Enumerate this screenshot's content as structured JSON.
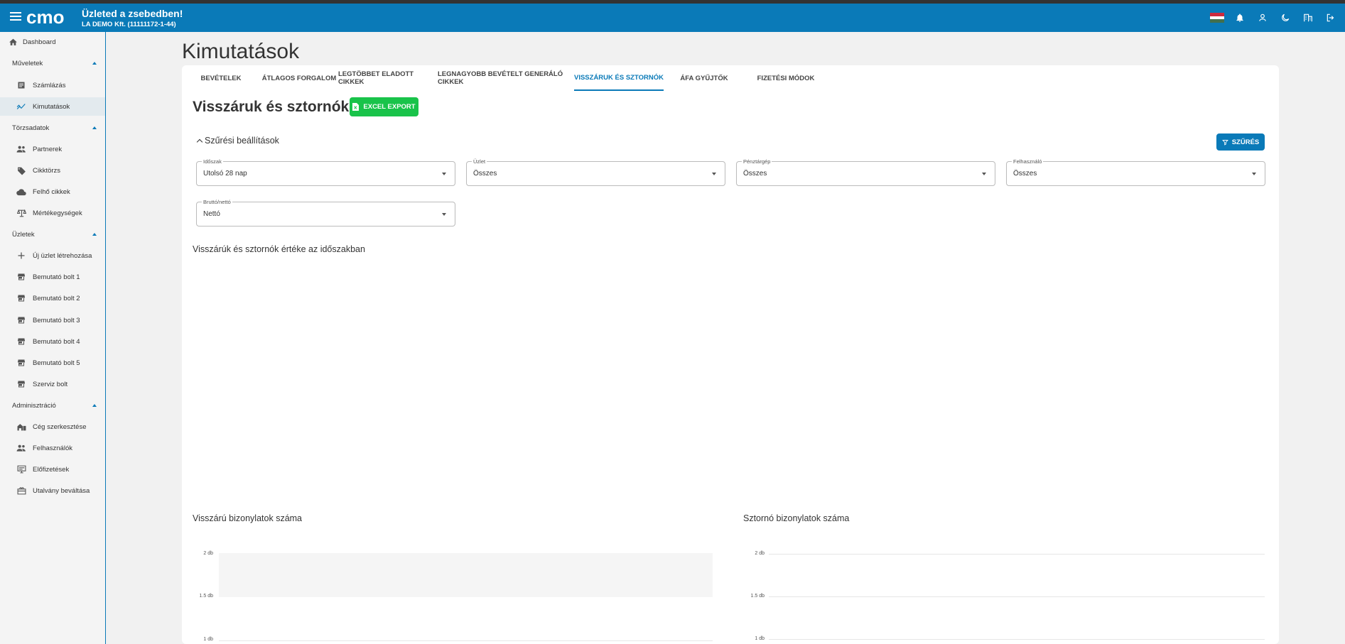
{
  "header": {
    "title": "Üzleted a zsebedben!",
    "company": "LA DEMO Kft. (11111172-1-44)",
    "logo_text": "cmo"
  },
  "sidebar": {
    "dashboard": "Dashboard",
    "groups": {
      "muveletek": "Műveletek",
      "torzsadatok": "Törzsadatok",
      "uzletek": "Üzletek",
      "adminisztracio": "Adminisztráció"
    },
    "items": {
      "szamlazas": "Számlázás",
      "kimutatasok": "Kimutatások",
      "partnerek": "Partnerek",
      "cikktorzs": "Cikktörzs",
      "felho": "Felhő cikkek",
      "mertekegysegek": "Mértékegységek",
      "uj_uzlet": "Új üzlet létrehozása",
      "bolt1": "Bemutató bolt 1",
      "bolt2": "Bemutató bolt 2",
      "bolt3": "Bemutató bolt 3",
      "bolt4": "Bemutató bolt 4",
      "bolt5": "Bemutató bolt 5",
      "szerviz": "Szerviz bolt",
      "ceg": "Cég szerkesztése",
      "felhasznalok": "Felhasználók",
      "elofizetesek": "Előfizetések",
      "utalvany": "Utalvány beváltása"
    }
  },
  "page": {
    "title": "Kimutatások"
  },
  "tabs": {
    "bevetelek": "BEVÉTELEK",
    "atlagos": "ÁTLAGOS FORGALOM",
    "legtobbet": "LEGTÖBBET ELADOTT CIKKEK",
    "legnagyobb": "LEGNAGYOBB BEVÉTELT GENERÁLÓ CIKKEK",
    "visszaruk": "VISSZÁRUK ÉS SZTORNÓK",
    "afa": "ÁFA GYŰJTŐK",
    "fizetesi": "FIZETÉSI MÓDOK"
  },
  "section": {
    "title": "Visszáruk és sztornók",
    "excel_label": "EXCEL EXPORT",
    "filter_toggle": "Szűrési beállítások",
    "filter_button": "SZŰRÉS"
  },
  "filters": {
    "idoszak": {
      "label": "Időszak",
      "value": "Utolsó 28 nap"
    },
    "uzlet": {
      "label": "Üzlet",
      "value": "Összes"
    },
    "penztargep": {
      "label": "Pénztárgép",
      "value": "Összes"
    },
    "felhasznalo": {
      "label": "Felhasználó",
      "value": "Összes"
    },
    "brutto_netto": {
      "label": "Bruttó/nettó",
      "value": "Nettó"
    }
  },
  "charts_titles": {
    "main": "Visszárúk és sztornók értéke az időszakban",
    "visszaru": "Visszárú bizonylatok száma",
    "sztorno": "Sztornó bizonylatok száma"
  },
  "colors": {
    "primary": "#0a7ab8",
    "excel": "#19c34a"
  },
  "chart_data": [
    {
      "type": "bar",
      "title": "Visszárúk és sztornók értéke az időszakban",
      "series": []
    },
    {
      "type": "bar",
      "title": "Visszárú bizonylatok száma",
      "yticks": [
        "2 db",
        "1.5 db",
        "1 db"
      ],
      "ylim": [
        1,
        2
      ],
      "series": []
    },
    {
      "type": "bar",
      "title": "Sztornó bizonylatok száma",
      "yticks": [
        "2 db",
        "1.5 db",
        "1 db"
      ],
      "ylim": [
        1,
        2
      ],
      "series": []
    }
  ]
}
